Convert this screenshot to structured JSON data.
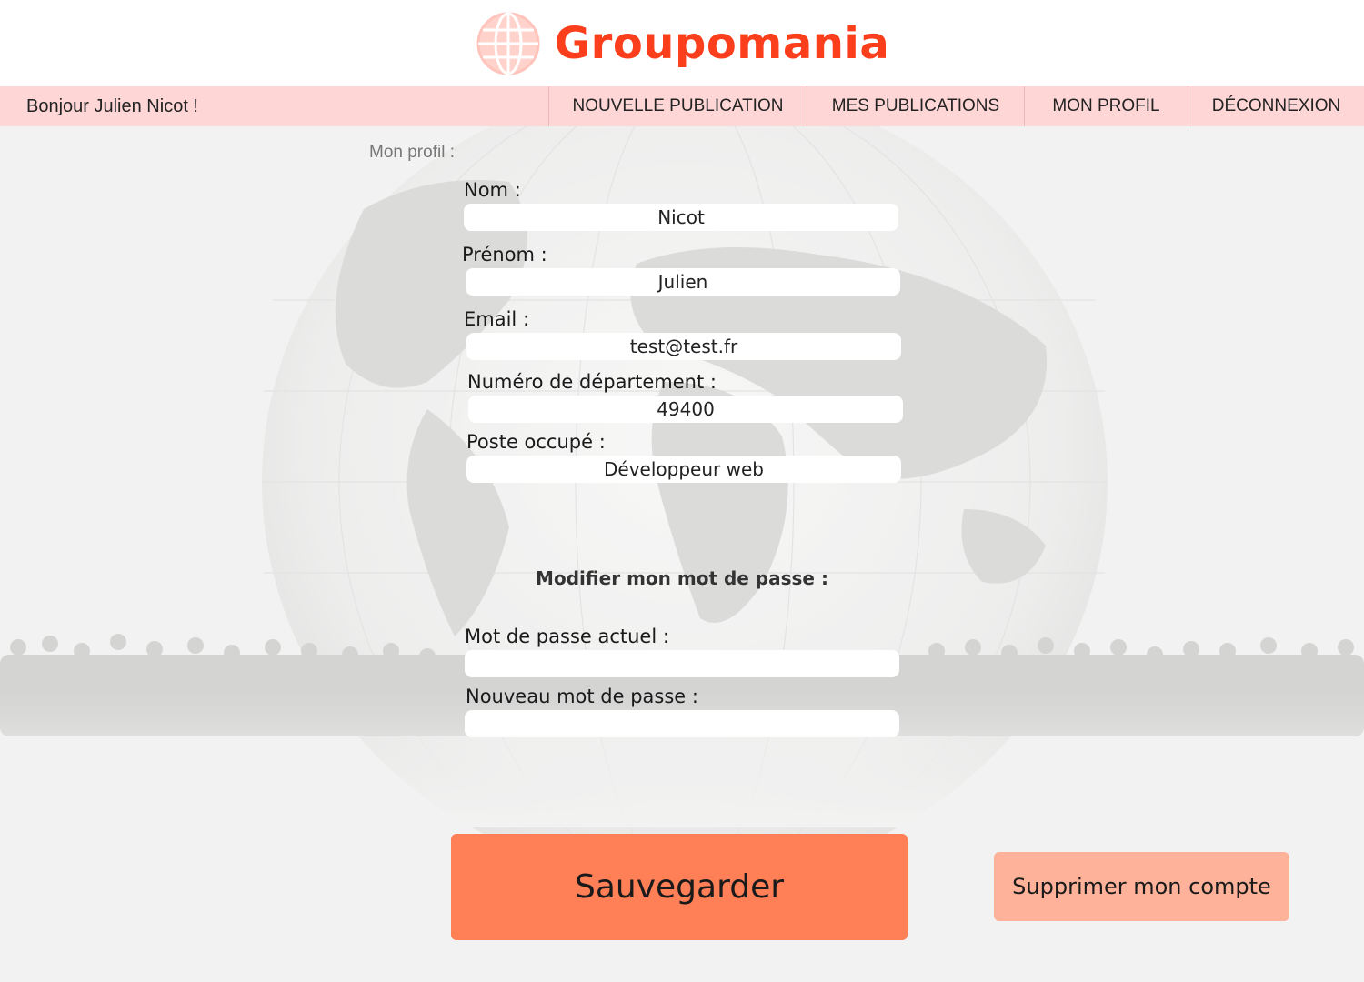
{
  "header": {
    "brand": "Groupomania",
    "logo_icon": "globe-icon",
    "brand_color": "#fb3f1c"
  },
  "nav": {
    "greeting": "Bonjour Julien Nicot !",
    "items": [
      {
        "label": "NOUVELLE PUBLICATION"
      },
      {
        "label": "MES PUBLICATIONS"
      },
      {
        "label": "MON PROFIL"
      },
      {
        "label": "DÉCONNEXION"
      }
    ],
    "background": "#ffd6d6"
  },
  "profile": {
    "section_title": "Mon profil :",
    "fields": {
      "nom": {
        "label": "Nom :",
        "value": "Nicot"
      },
      "prenom": {
        "label": "Prénom :",
        "value": "Julien"
      },
      "email": {
        "label": "Email :",
        "value": "test@test.fr"
      },
      "departement": {
        "label": "Numéro de département :",
        "value": "49400"
      },
      "poste": {
        "label": "Poste occupé :",
        "value": "Développeur web"
      }
    },
    "password": {
      "heading": "Modifier mon mot de passe :",
      "current_label": "Mot de passe actuel :",
      "current_value": "",
      "new_label": "Nouveau mot de passe :",
      "new_value": ""
    }
  },
  "actions": {
    "save_label": "Sauvegarder",
    "save_color": "#ff7f57",
    "delete_label": "Supprimer mon compte",
    "delete_color": "#ffb29a"
  }
}
